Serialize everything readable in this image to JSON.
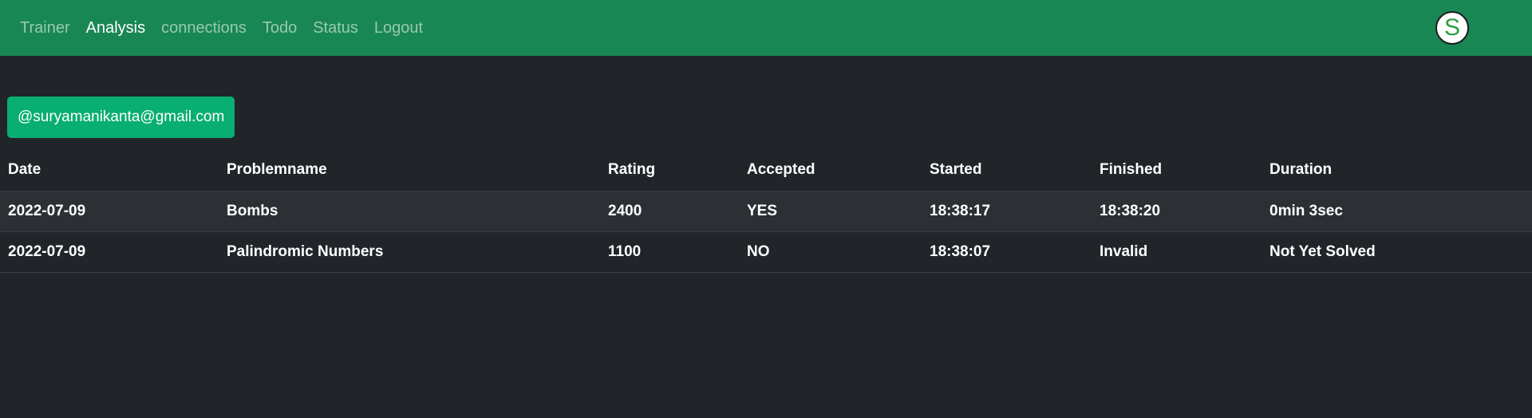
{
  "nav": {
    "links": [
      {
        "label": "Trainer",
        "active": false
      },
      {
        "label": "Analysis",
        "active": true
      },
      {
        "label": "connections",
        "active": false
      },
      {
        "label": "Todo",
        "active": false
      },
      {
        "label": "Status",
        "active": false
      },
      {
        "label": "Logout",
        "active": false
      }
    ],
    "avatar_letter": "S"
  },
  "user": {
    "handle": "@suryamanikanta@gmail.com"
  },
  "table": {
    "headers": [
      "Date",
      "Problemname",
      "Rating",
      "Accepted",
      "Started",
      "Finished",
      "Duration"
    ],
    "rows": [
      [
        "2022-07-09",
        "Bombs",
        "2400",
        "YES",
        "18:38:17",
        "18:38:20",
        "0min 3sec"
      ],
      [
        "2022-07-09",
        "Palindromic Numbers",
        "1100",
        "NO",
        "18:38:07",
        "Invalid",
        "Not Yet Solved"
      ]
    ]
  },
  "colors": {
    "navbar": "#198754",
    "background": "#212529",
    "badge": "#09ae72"
  }
}
